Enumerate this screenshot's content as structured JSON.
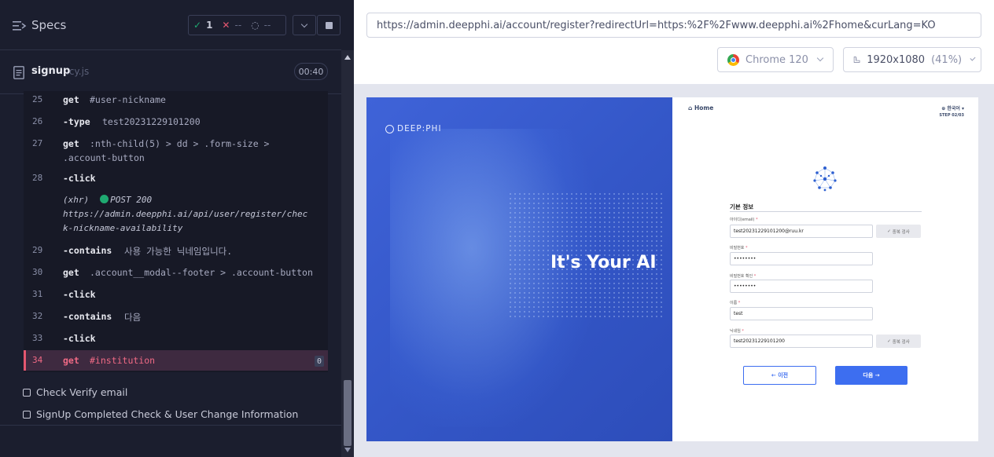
{
  "runner": {
    "specs_label": "Specs",
    "stats": {
      "passed": "1",
      "failed": "--",
      "pending": "--"
    },
    "file": {
      "name": "signup",
      "ext": ".cy.js",
      "duration": "00:40"
    }
  },
  "commands": [
    {
      "num": "25",
      "name": "get",
      "arg": "#user-nickname"
    },
    {
      "num": "26",
      "name": "-type",
      "arg": "test20231229101200"
    },
    {
      "num": "27",
      "name": "get",
      "arg": ":nth-child(5) > dd > .form-size >",
      "arg2": ".account-button"
    },
    {
      "num": "28",
      "name": "-click",
      "arg": ""
    },
    {
      "num": "29",
      "name": "-contains",
      "arg": "사용 가능한 닉네임입니다."
    },
    {
      "num": "30",
      "name": "get",
      "arg": ".account__modal--footer > .account-button"
    },
    {
      "num": "31",
      "name": "-click",
      "arg": ""
    },
    {
      "num": "32",
      "name": "-contains",
      "arg": "다음"
    },
    {
      "num": "33",
      "name": "-click",
      "arg": ""
    },
    {
      "num": "34",
      "name": "get",
      "arg": "#institution",
      "count": "0"
    }
  ],
  "xhr": {
    "label": "(xhr)",
    "method_status": "POST 200",
    "url_line1": "https://admin.deepphi.ai/api/user/register/chec",
    "url_line2": "k-nickname-availability"
  },
  "tests": [
    "Check Verify email",
    "SignUp Completed Check & User Change Information"
  ],
  "browser": {
    "url": "https://admin.deepphi.ai/account/register?redirectUrl=https:%2F%2Fwww.deepphi.ai%2Fhome&curLang=KO",
    "name": "Chrome 120",
    "viewport": "1920x1080",
    "scale": "(41%)"
  },
  "aut": {
    "brand": "DEEP:PHI",
    "tagline": "It's Your AI",
    "home": "Home",
    "lang": "한국어",
    "step": "STEP 02/03",
    "section_title": "기본 정보",
    "fields": [
      {
        "label": "아이디(email)",
        "value": "test20231229101200@ruu.kr",
        "check": "중복 검사"
      },
      {
        "label": "비밀번호",
        "value": "••••••••"
      },
      {
        "label": "비밀번호 확인",
        "value": "••••••••"
      },
      {
        "label": "이름",
        "value": "test"
      },
      {
        "label": "닉네임",
        "value": "test20231229101200",
        "check": "중복 검사"
      }
    ],
    "prev_label": "← 이전",
    "next_label": "다음 →"
  }
}
